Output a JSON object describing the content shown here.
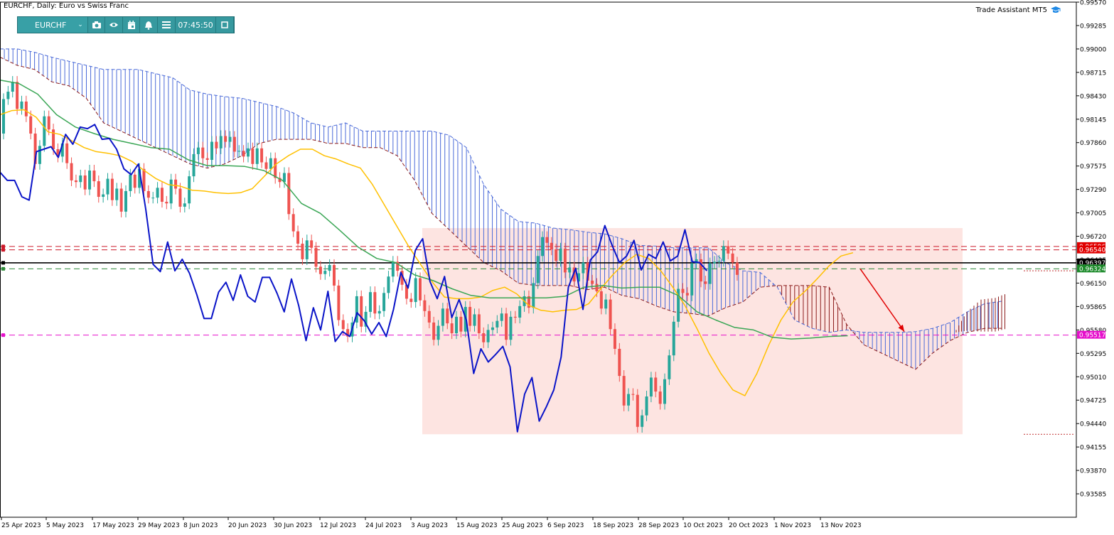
{
  "window": {
    "title": "EURCHF, Daily:  Euro vs Swiss Franc",
    "assistant_label": "Trade Assistant MT5"
  },
  "toolbar": {
    "symbol": "EURCHF",
    "time": "07:45:50",
    "buttons": [
      "camera-icon",
      "eye-icon",
      "calendar-icon",
      "alert-icon",
      "menu-icon",
      "window-icon"
    ]
  },
  "colors": {
    "bull": "#26a69a",
    "bear": "#ef5350",
    "tenkan": "#ffc000",
    "kijun": "#3aa655",
    "chikou": "#0a14c8",
    "cloud_up": "#4a6ad8",
    "cloud_down": "#8b1a1a",
    "zone": "#fde1de",
    "magenta": "#e60ecb"
  },
  "chart_data": {
    "type": "candlestick",
    "symbol": "EURCHF",
    "timeframe": "Daily",
    "y_axis": {
      "min": 0.933,
      "max": 0.9957,
      "ticks": [
        "0.99570",
        "0.99285",
        "0.99000",
        "0.98715",
        "0.98430",
        "0.98145",
        "0.97860",
        "0.97575",
        "0.97290",
        "0.97005",
        "0.96720",
        "0.96435",
        "0.96150",
        "0.95865",
        "0.95580",
        "0.95295",
        "0.95010",
        "0.94725",
        "0.94440",
        "0.94155",
        "0.93870",
        "0.93585"
      ]
    },
    "x_axis": {
      "labels": [
        "25 Apr 2023",
        "5 May 2023",
        "17 May 2023",
        "29 May 2023",
        "8 Jun 2023",
        "20 Jun 2023",
        "30 Jun 2023",
        "12 Jul 2023",
        "24 Jul 2023",
        "3 Aug 2023",
        "15 Aug 2023",
        "25 Aug 2023",
        "6 Sep 2023",
        "18 Sep 2023",
        "28 Sep 2023",
        "10 Oct 2023",
        "20 Oct 2023",
        "1 Nov 2023",
        "13 Nov 2023"
      ]
    },
    "price_labels": [
      {
        "text": "0.96596",
        "color": "#e00000",
        "price": 0.96596
      },
      {
        "text": "0.96540",
        "color": "#e00000",
        "price": 0.96555
      },
      {
        "text": "0.96397",
        "color": "#000000",
        "price": 0.96397
      },
      {
        "text": "0.96324",
        "color": "#1c8a2a",
        "price": 0.96324
      },
      {
        "text": "0.95517",
        "color": "#e60ecb",
        "price": 0.95517
      }
    ],
    "horizontal_lines": [
      {
        "price": 0.96596,
        "style": "dashed",
        "color": "#cc1b2b"
      },
      {
        "price": 0.96555,
        "style": "dashed",
        "color": "#cc1b2b"
      },
      {
        "price": 0.96397,
        "style": "solid",
        "color": "#000000"
      },
      {
        "price": 0.96324,
        "style": "dashed",
        "color": "#2e8b3a"
      },
      {
        "price": 0.95517,
        "style": "dashed",
        "color": "#e60ecb"
      }
    ],
    "zone": {
      "from_date": "3 Aug 2023",
      "price_top": 0.9682,
      "price_bottom": 0.9431
    },
    "arrow": {
      "price_from": 0.96324,
      "price_to": 0.9556
    },
    "candles": [
      [
        0.9797,
        0.9839
      ],
      [
        0.9839,
        0.9848
      ],
      [
        0.9848,
        0.986
      ],
      [
        0.986,
        0.9827
      ],
      [
        0.9827,
        0.9836
      ],
      [
        0.9836,
        0.9818
      ],
      [
        0.9818,
        0.9797
      ],
      [
        0.9797,
        0.976
      ],
      [
        0.976,
        0.9782
      ],
      [
        0.9782,
        0.9818
      ],
      [
        0.9818,
        0.9802
      ],
      [
        0.9802,
        0.9778
      ],
      [
        0.9778,
        0.9769
      ],
      [
        0.9769,
        0.9785
      ],
      [
        0.9785,
        0.9761
      ],
      [
        0.9761,
        0.974
      ],
      [
        0.974,
        0.9738
      ],
      [
        0.9738,
        0.9746
      ],
      [
        0.9746,
        0.9729
      ],
      [
        0.9729,
        0.9752
      ],
      [
        0.9752,
        0.9739
      ],
      [
        0.9739,
        0.972
      ],
      [
        0.972,
        0.9723
      ],
      [
        0.9723,
        0.9742
      ],
      [
        0.9742,
        0.9716
      ],
      [
        0.9716,
        0.973
      ],
      [
        0.973,
        0.9702
      ],
      [
        0.9702,
        0.9727
      ],
      [
        0.9727,
        0.9747
      ],
      [
        0.9747,
        0.9731
      ],
      [
        0.9731,
        0.9754
      ],
      [
        0.9754,
        0.9727
      ],
      [
        0.9727,
        0.9719
      ],
      [
        0.9719,
        0.9719
      ],
      [
        0.9719,
        0.9731
      ],
      [
        0.9731,
        0.9714
      ],
      [
        0.9714,
        0.9712
      ],
      [
        0.9712,
        0.9741
      ],
      [
        0.9741,
        0.973
      ],
      [
        0.973,
        0.9708
      ],
      [
        0.9708,
        0.9712
      ],
      [
        0.9712,
        0.9745
      ],
      [
        0.9745,
        0.9772
      ],
      [
        0.9772,
        0.978
      ],
      [
        0.978,
        0.9767
      ],
      [
        0.9767,
        0.9765
      ],
      [
        0.9765,
        0.9787
      ],
      [
        0.9787,
        0.9779
      ],
      [
        0.9779,
        0.9794
      ],
      [
        0.9794,
        0.9787
      ],
      [
        0.9787,
        0.9793
      ],
      [
        0.9793,
        0.9775
      ],
      [
        0.9775,
        0.9776
      ],
      [
        0.9776,
        0.9769
      ],
      [
        0.9769,
        0.9779
      ],
      [
        0.9779,
        0.976
      ],
      [
        0.976,
        0.9779
      ],
      [
        0.9779,
        0.9762
      ],
      [
        0.9762,
        0.9754
      ],
      [
        0.9754,
        0.9767
      ],
      [
        0.9767,
        0.9743
      ],
      [
        0.9743,
        0.9738
      ],
      [
        0.9738,
        0.9749
      ],
      [
        0.9749,
        0.9699
      ],
      [
        0.9699,
        0.9678
      ],
      [
        0.9678,
        0.9663
      ],
      [
        0.9663,
        0.9644
      ],
      [
        0.9644,
        0.9667
      ],
      [
        0.9667,
        0.9658
      ],
      [
        0.9658,
        0.9635
      ],
      [
        0.9635,
        0.9626
      ],
      [
        0.9626,
        0.963
      ],
      [
        0.963,
        0.9637
      ],
      [
        0.9637,
        0.9612
      ],
      [
        0.9612,
        0.957
      ],
      [
        0.957,
        0.9559
      ],
      [
        0.9559,
        0.955
      ],
      [
        0.955,
        0.9567
      ],
      [
        0.9567,
        0.9599
      ],
      [
        0.9599,
        0.9562
      ],
      [
        0.9562,
        0.958
      ],
      [
        0.958,
        0.9604
      ],
      [
        0.9604,
        0.9578
      ],
      [
        0.9578,
        0.9581
      ],
      [
        0.9581,
        0.9603
      ],
      [
        0.9603,
        0.9623
      ],
      [
        0.9623,
        0.9641
      ],
      [
        0.9641,
        0.963
      ],
      [
        0.963,
        0.9613
      ],
      [
        0.9613,
        0.9596
      ],
      [
        0.9596,
        0.9592
      ],
      [
        0.9592,
        0.9621
      ],
      [
        0.9621,
        0.9594
      ],
      [
        0.9594,
        0.9581
      ],
      [
        0.9581,
        0.9567
      ],
      [
        0.9567,
        0.9546
      ],
      [
        0.9546,
        0.9563
      ],
      [
        0.9563,
        0.9584
      ],
      [
        0.9584,
        0.9566
      ],
      [
        0.9566,
        0.9554
      ],
      [
        0.9554,
        0.9574
      ],
      [
        0.9574,
        0.9556
      ],
      [
        0.9556,
        0.9586
      ],
      [
        0.9586,
        0.9563
      ],
      [
        0.9563,
        0.9577
      ],
      [
        0.9577,
        0.9554
      ],
      [
        0.9554,
        0.9543
      ],
      [
        0.9543,
        0.9558
      ],
      [
        0.9558,
        0.9561
      ],
      [
        0.9561,
        0.9569
      ],
      [
        0.9569,
        0.9578
      ],
      [
        0.9578,
        0.9546
      ],
      [
        0.9546,
        0.9574
      ],
      [
        0.9574,
        0.9573
      ],
      [
        0.9573,
        0.9587
      ],
      [
        0.9587,
        0.9599
      ],
      [
        0.9599,
        0.9585
      ],
      [
        0.9585,
        0.9615
      ],
      [
        0.9615,
        0.9648
      ],
      [
        0.9648,
        0.9671
      ],
      [
        0.9671,
        0.9664
      ],
      [
        0.9664,
        0.9656
      ],
      [
        0.9656,
        0.9642
      ],
      [
        0.9642,
        0.9657
      ],
      [
        0.9657,
        0.9628
      ],
      [
        0.9628,
        0.9634
      ],
      [
        0.9634,
        0.9617
      ],
      [
        0.9617,
        0.9627
      ],
      [
        0.9627,
        0.964
      ],
      [
        0.964,
        0.9618
      ],
      [
        0.9618,
        0.9614
      ],
      [
        0.9614,
        0.9605
      ],
      [
        0.9605,
        0.9584
      ],
      [
        0.9584,
        0.9595
      ],
      [
        0.9595,
        0.9559
      ],
      [
        0.9559,
        0.9535
      ],
      [
        0.9535,
        0.9502
      ],
      [
        0.9502,
        0.9466
      ],
      [
        0.9466,
        0.948
      ],
      [
        0.948,
        0.9479
      ],
      [
        0.9479,
        0.944
      ],
      [
        0.944,
        0.9454
      ],
      [
        0.9454,
        0.9477
      ],
      [
        0.9477,
        0.95
      ],
      [
        0.95,
        0.9483
      ],
      [
        0.9483,
        0.9468
      ],
      [
        0.9468,
        0.9498
      ],
      [
        0.9498,
        0.9527
      ],
      [
        0.9527,
        0.9568
      ],
      [
        0.9568,
        0.9608
      ],
      [
        0.9608,
        0.9603
      ],
      [
        0.9603,
        0.96
      ],
      [
        0.96,
        0.9639
      ],
      [
        0.9639,
        0.9644
      ],
      [
        0.9644,
        0.9617
      ],
      [
        0.9617,
        0.9614
      ],
      [
        0.9614,
        0.9639
      ],
      [
        0.9639,
        0.9641
      ],
      [
        0.9641,
        0.9642
      ],
      [
        0.9642,
        0.966
      ],
      [
        0.966,
        0.9651
      ],
      [
        0.9651,
        0.964
      ],
      [
        0.964,
        0.9625
      ]
    ],
    "tenkan": [
      0.982,
      0.9825,
      0.9826,
      0.9817,
      0.9799,
      0.9796,
      0.9788,
      0.978,
      0.9775,
      0.9773,
      0.977,
      0.9763,
      0.9752,
      0.9742,
      0.9735,
      0.9733,
      0.9728,
      0.9727,
      0.9725,
      0.9724,
      0.9725,
      0.973,
      0.9745,
      0.976,
      0.977,
      0.9778,
      0.9778,
      0.977,
      0.9766,
      0.976,
      0.9755,
      0.9735,
      0.971,
      0.9685,
      0.966,
      0.9638,
      0.9616,
      0.9598,
      0.9596,
      0.9596,
      0.9598,
      0.9606,
      0.961,
      0.9602,
      0.9588,
      0.9582,
      0.958,
      0.9582,
      0.9583,
      0.959,
      0.9608,
      0.9625,
      0.964,
      0.965,
      0.9645,
      0.963,
      0.961,
      0.9588,
      0.956,
      0.953,
      0.9505,
      0.9485,
      0.9478,
      0.9505,
      0.954,
      0.957,
      0.9592,
      0.9605,
      0.962,
      0.9636,
      0.9648,
      0.9652
    ],
    "kijun": [
      0.9862,
      0.9858,
      0.9845,
      0.982,
      0.9805,
      0.9797,
      0.979,
      0.9785,
      0.978,
      0.9778,
      0.9765,
      0.9758,
      0.9758,
      0.9757,
      0.9752,
      0.974,
      0.9712,
      0.97,
      0.968,
      0.9659,
      0.9645,
      0.964,
      0.9625,
      0.9618,
      0.9608,
      0.96,
      0.9597,
      0.9597,
      0.9597,
      0.9597,
      0.9599,
      0.961,
      0.9612,
      0.9609,
      0.961,
      0.961,
      0.96,
      0.958,
      0.957,
      0.9561,
      0.9558,
      0.9549,
      0.9547,
      0.9548,
      0.955,
      0.9551
    ],
    "chikou": [
      0.975,
      0.974,
      0.974,
      0.972,
      0.9716,
      0.9775,
      0.9778,
      0.9781,
      0.9768,
      0.9796,
      0.9784,
      0.9805,
      0.9803,
      0.9808,
      0.979,
      0.9791,
      0.9778,
      0.9754,
      0.9747,
      0.976,
      0.9705,
      0.9638,
      0.9629,
      0.9665,
      0.963,
      0.9644,
      0.9627,
      0.9601,
      0.9572,
      0.9572,
      0.9604,
      0.9616,
      0.9594,
      0.9625,
      0.9599,
      0.9592,
      0.9622,
      0.9622,
      0.9603,
      0.958,
      0.962,
      0.9587,
      0.9545,
      0.9585,
      0.9558,
      0.9605,
      0.9544,
      0.9556,
      0.955,
      0.9579,
      0.9569,
      0.9553,
      0.9567,
      0.955,
      0.9583,
      0.9628,
      0.9609,
      0.9655,
      0.9669,
      0.9617,
      0.9596,
      0.9623,
      0.9573,
      0.9595,
      0.957,
      0.9505,
      0.9535,
      0.9519,
      0.9528,
      0.9538,
      0.9513,
      0.9434,
      0.948,
      0.95,
      0.9447,
      0.9465,
      0.9485,
      0.9525,
      0.961,
      0.9633,
      0.9583,
      0.9643,
      0.9653,
      0.9685,
      0.9661,
      0.964,
      0.9648,
      0.9667,
      0.9631,
      0.965,
      0.9645,
      0.9665,
      0.9642,
      0.9648,
      0.968,
      0.9641,
      0.964,
      0.963
    ],
    "cloud_upper": [
      0.99,
      0.99,
      0.9896,
      0.989,
      0.9885,
      0.988,
      0.9875,
      0.9875,
      0.9875,
      0.987,
      0.9865,
      0.985,
      0.9845,
      0.9842,
      0.984,
      0.9835,
      0.983,
      0.9822,
      0.981,
      0.9805,
      0.981,
      0.98,
      0.98,
      0.98,
      0.98,
      0.98,
      0.9795,
      0.978,
      0.9735,
      0.9705,
      0.969,
      0.9688,
      0.9682,
      0.968,
      0.9677,
      0.9675,
      0.9669,
      0.9661,
      0.966,
      0.9658,
      0.9658,
      0.9658,
      0.964,
      0.963,
      0.9628,
      0.961,
      0.957,
      0.956,
      0.9555,
      0.9558,
      0.9555,
      0.9555,
      0.9555,
      0.9556,
      0.956,
      0.9567,
      0.958,
      0.959,
      0.9593
    ],
    "cloud_lower": [
      0.989,
      0.988,
      0.9875,
      0.986,
      0.9855,
      0.984,
      0.981,
      0.98,
      0.979,
      0.978,
      0.977,
      0.976,
      0.9755,
      0.976,
      0.977,
      0.9785,
      0.979,
      0.979,
      0.979,
      0.9785,
      0.9785,
      0.978,
      0.978,
      0.977,
      0.974,
      0.97,
      0.968,
      0.966,
      0.964,
      0.963,
      0.9615,
      0.9612,
      0.9612,
      0.9612,
      0.9607,
      0.961,
      0.96,
      0.9596,
      0.9587,
      0.958,
      0.9578,
      0.9575,
      0.9585,
      0.9592,
      0.961,
      0.9612,
      0.9612,
      0.9612,
      0.961,
      0.9565,
      0.954,
      0.953,
      0.952,
      0.951,
      0.953,
      0.9545,
      0.9555,
      0.956,
      0.956
    ]
  }
}
